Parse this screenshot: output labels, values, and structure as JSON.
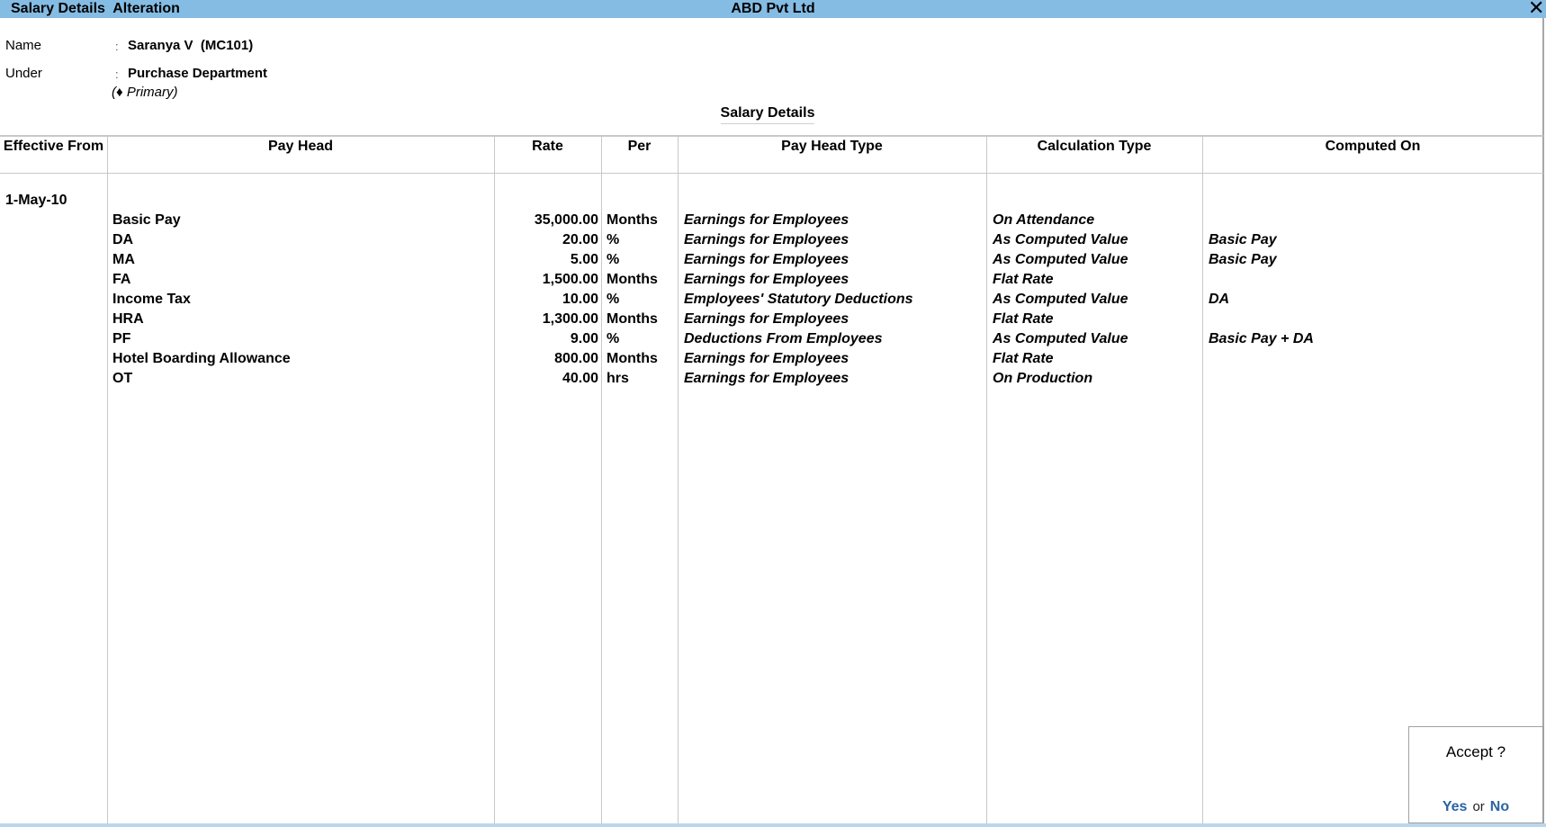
{
  "titlebar": {
    "screen_title": "Salary Details  Alteration",
    "company": "ABD Pvt Ltd",
    "close_icon": "close-icon"
  },
  "employee": {
    "name_label": "Name",
    "name_value": "Saranya V  (MC101)",
    "under_label": "Under",
    "under_value": "Purchase Department",
    "under_parent": "(♦ Primary)",
    "colon": ":"
  },
  "section_title": "Salary Details",
  "table": {
    "headers": {
      "effective_from": "Effective From",
      "pay_head": "Pay Head",
      "rate": "Rate",
      "per": "Per",
      "pay_head_type": "Pay Head Type",
      "calculation_type": "Calculation Type",
      "computed_on": "Computed On"
    },
    "effective_from": "1-May-10",
    "rows": [
      {
        "pay_head": "Basic Pay",
        "rate": "35,000.00",
        "per": "Months",
        "pay_head_type": "Earnings for Employees",
        "calculation_type": "On Attendance",
        "computed_on": ""
      },
      {
        "pay_head": "DA",
        "rate": "20.00",
        "per": "%",
        "pay_head_type": "Earnings for Employees",
        "calculation_type": "As Computed Value",
        "computed_on": "Basic Pay"
      },
      {
        "pay_head": "MA",
        "rate": "5.00",
        "per": "%",
        "pay_head_type": "Earnings for Employees",
        "calculation_type": "As Computed Value",
        "computed_on": "Basic Pay"
      },
      {
        "pay_head": "FA",
        "rate": "1,500.00",
        "per": "Months",
        "pay_head_type": "Earnings for Employees",
        "calculation_type": "Flat Rate",
        "computed_on": ""
      },
      {
        "pay_head": "Income Tax",
        "rate": "10.00",
        "per": "%",
        "pay_head_type": "Employees' Statutory Deductions",
        "calculation_type": "As Computed Value",
        "computed_on": "DA"
      },
      {
        "pay_head": "HRA",
        "rate": "1,300.00",
        "per": "Months",
        "pay_head_type": "Earnings for Employees",
        "calculation_type": "Flat Rate",
        "computed_on": ""
      },
      {
        "pay_head": "PF",
        "rate": "9.00",
        "per": "%",
        "pay_head_type": "Deductions From Employees",
        "calculation_type": "As Computed Value",
        "computed_on": "Basic Pay + DA"
      },
      {
        "pay_head": "Hotel Boarding Allowance",
        "rate": "800.00",
        "per": "Months",
        "pay_head_type": "Earnings for Employees",
        "calculation_type": "Flat Rate",
        "computed_on": ""
      },
      {
        "pay_head": "OT",
        "rate": "40.00",
        "per": "hrs",
        "pay_head_type": "Earnings for Employees",
        "calculation_type": "On Production",
        "computed_on": ""
      }
    ]
  },
  "accept_dialog": {
    "question": "Accept ?",
    "yes": "Yes",
    "or": "or",
    "no": "No"
  },
  "colors": {
    "titlebar": "#85bce4",
    "accent_link": "#2a64a3",
    "grid_line": "#c8c8c8"
  }
}
